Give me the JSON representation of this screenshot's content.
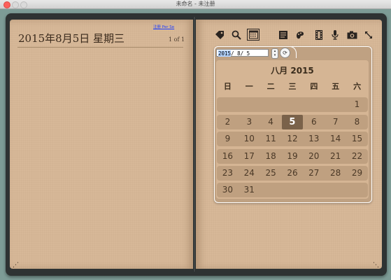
{
  "window": {
    "title": "未命名 - 未注册"
  },
  "page_header": {
    "date_title": "2015年8月5日 星期三",
    "page_count": "1 of 1",
    "register_link": "注册 Per Se"
  },
  "toolbar": {
    "icons": [
      "tag-icon",
      "search-icon",
      "calendar-icon",
      "notes-icon",
      "paint-icon",
      "film-icon",
      "microphone-icon",
      "camera-icon",
      "expand-icon"
    ]
  },
  "calendar": {
    "date_input_selected": "2015",
    "date_input_rest": "/  8/  5",
    "month_title": "八月 2015",
    "weekdays": [
      "日",
      "一",
      "二",
      "三",
      "四",
      "五",
      "六"
    ],
    "weeks": [
      [
        "",
        "",
        "",
        "",
        "",
        "",
        "1"
      ],
      [
        "2",
        "3",
        "4",
        "5",
        "6",
        "7",
        "8"
      ],
      [
        "9",
        "10",
        "11",
        "12",
        "13",
        "14",
        "15"
      ],
      [
        "16",
        "17",
        "18",
        "19",
        "20",
        "21",
        "22"
      ],
      [
        "23",
        "24",
        "25",
        "26",
        "27",
        "28",
        "29"
      ],
      [
        "30",
        "31",
        "",
        "",
        "",
        "",
        ""
      ]
    ],
    "selected_day": "5",
    "colors": {
      "selected_bg": "#7a624a",
      "row_bg": "#bfa080",
      "page_bg": "#d7b898"
    }
  }
}
